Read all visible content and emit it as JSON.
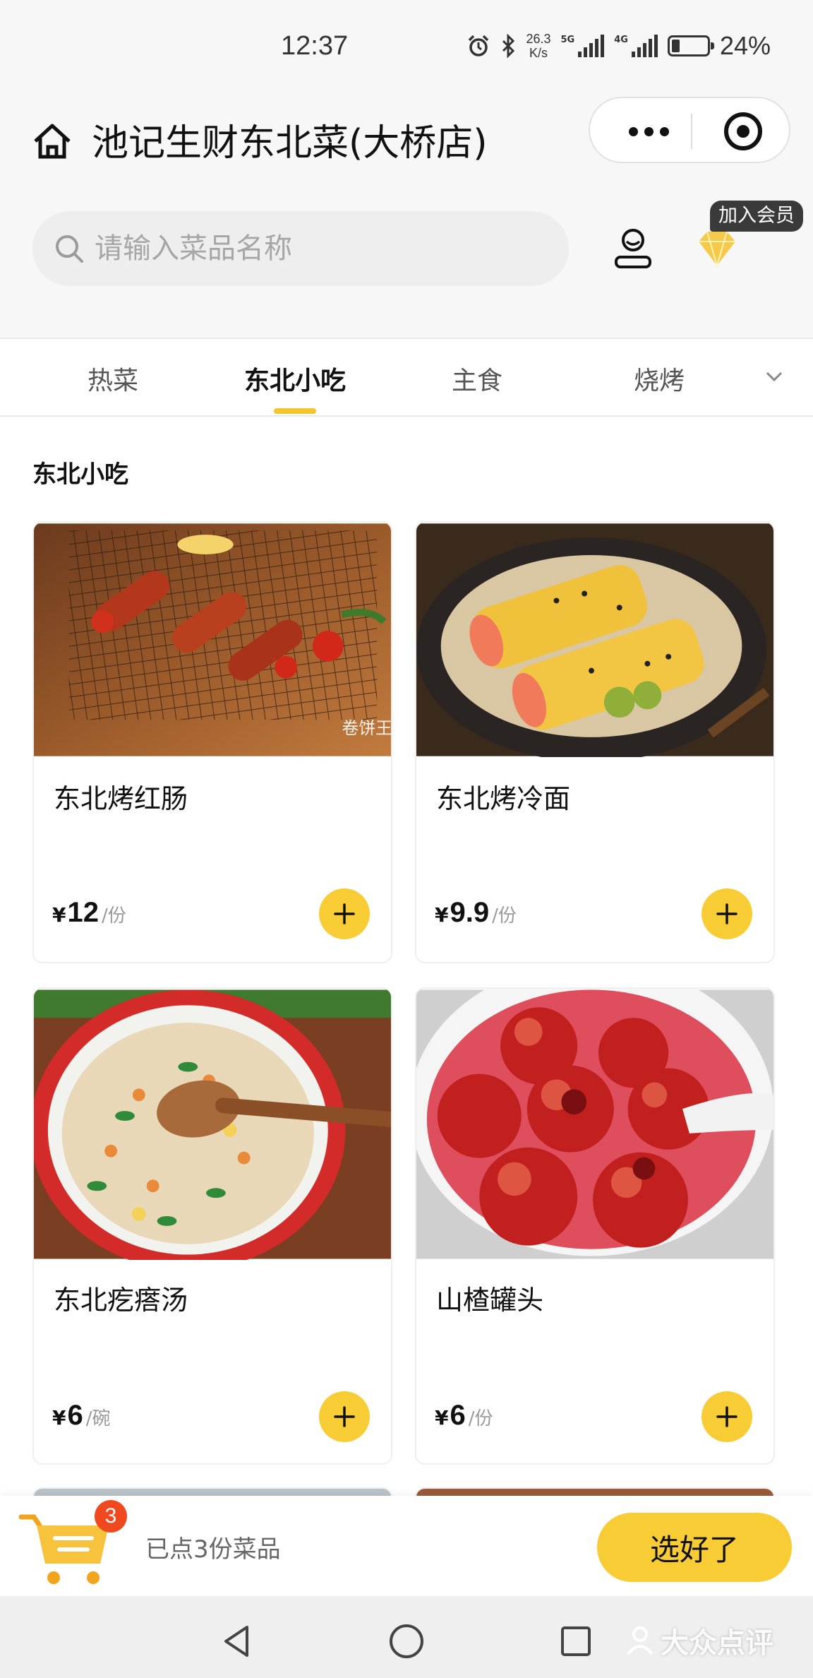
{
  "status_bar": {
    "time": "12:37",
    "net_speed_value": "26.3",
    "net_speed_unit": "K/s",
    "signal1_label": "5G",
    "signal2_label": "4G",
    "battery_percent": "24%",
    "battery_level": 0.24
  },
  "header": {
    "store_name": "池记生财东北菜(大桥店)"
  },
  "search": {
    "placeholder": "请输入菜品名称"
  },
  "member": {
    "tag": "加入会员"
  },
  "tabs": [
    {
      "label": "热菜",
      "active": false
    },
    {
      "label": "东北小吃",
      "active": true
    },
    {
      "label": "主食",
      "active": false
    },
    {
      "label": "烧烤",
      "active": false
    }
  ],
  "section": {
    "title": "东北小吃"
  },
  "dishes": [
    {
      "name": "东北烤红肠",
      "currency": "¥",
      "price": "12",
      "unit": "/份",
      "photo_watermark": "卷饼王"
    },
    {
      "name": "东北烤冷面",
      "currency": "¥",
      "price": "9.9",
      "unit": "/份"
    },
    {
      "name": "东北疙瘩汤",
      "currency": "¥",
      "price": "6",
      "unit": "/碗"
    },
    {
      "name": "山楂罐头",
      "currency": "¥",
      "price": "6",
      "unit": "/份"
    }
  ],
  "cart": {
    "count": "3",
    "summary": "已点3份菜品",
    "checkout_label": "选好了"
  },
  "watermark": {
    "text": "大众点评"
  },
  "colors": {
    "accent_yellow": "#f8cc34",
    "badge_red": "#f0491f",
    "tab_indicator": "#f5c530"
  }
}
